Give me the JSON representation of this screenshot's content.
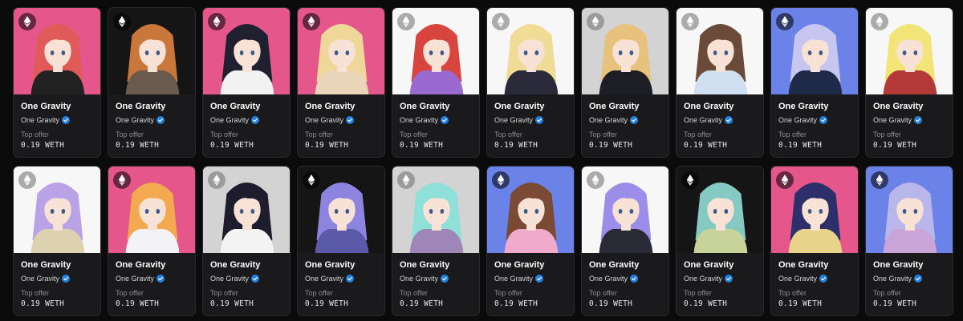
{
  "cards": [
    {
      "title": "One Gravity",
      "collection": "One Gravity",
      "offer_label": "Top offer",
      "offer_value": "0.19 WETH",
      "bg": "#e5578b",
      "hair": "#e05a5a",
      "outfit": "#222222",
      "chain": "dark"
    },
    {
      "title": "One Gravity",
      "collection": "One Gravity",
      "offer_label": "Top offer",
      "offer_value": "0.19 WETH",
      "bg": "#151515",
      "hair": "#c9773a",
      "outfit": "#6b5a4e",
      "chain": "dark"
    },
    {
      "title": "One Gravity",
      "collection": "One Gravity",
      "offer_label": "Top offer",
      "offer_value": "0.19 WETH",
      "bg": "#e5578b",
      "hair": "#202030",
      "outfit": "#f2f2f2",
      "chain": "dark"
    },
    {
      "title": "One Gravity",
      "collection": "One Gravity",
      "offer_label": "Top offer",
      "offer_value": "0.19 WETH",
      "bg": "#e5578b",
      "hair": "#efd79a",
      "outfit": "#e9d6b8",
      "chain": "dark"
    },
    {
      "title": "One Gravity",
      "collection": "One Gravity",
      "offer_label": "Top offer",
      "offer_value": "0.19 WETH",
      "bg": "#f7f7f7",
      "hair": "#d8453f",
      "outfit": "#9b6ad0",
      "chain": "light"
    },
    {
      "title": "One Gravity",
      "collection": "One Gravity",
      "offer_label": "Top offer",
      "offer_value": "0.19 WETH",
      "bg": "#f7f7f7",
      "hair": "#f0dc96",
      "outfit": "#2a2a3a",
      "chain": "light"
    },
    {
      "title": "One Gravity",
      "collection": "One Gravity",
      "offer_label": "Top offer",
      "offer_value": "0.19 WETH",
      "bg": "#d3d3d3",
      "hair": "#e6c27d",
      "outfit": "#1d1d26",
      "chain": "light"
    },
    {
      "title": "One Gravity",
      "collection": "One Gravity",
      "offer_label": "Top offer",
      "offer_value": "0.19 WETH",
      "bg": "#f7f7f7",
      "hair": "#6b4a3a",
      "outfit": "#cfdff0",
      "chain": "light"
    },
    {
      "title": "One Gravity",
      "collection": "One Gravity",
      "offer_label": "Top offer",
      "offer_value": "0.19 WETH",
      "bg": "#6b82e8",
      "hair": "#c6c6f0",
      "outfit": "#1e2a48",
      "chain": "dark"
    },
    {
      "title": "One Gravity",
      "collection": "One Gravity",
      "offer_label": "Top offer",
      "offer_value": "0.19 WETH",
      "bg": "#f7f7f7",
      "hair": "#f3e477",
      "outfit": "#b43a3a",
      "chain": "light"
    },
    {
      "title": "One Gravity",
      "collection": "One Gravity",
      "offer_label": "Top offer",
      "offer_value": "0.19 WETH",
      "bg": "#f7f7f7",
      "hair": "#b9a2e6",
      "outfit": "#ddd2b0",
      "chain": "light"
    },
    {
      "title": "One Gravity",
      "collection": "One Gravity",
      "offer_label": "Top offer",
      "offer_value": "0.19 WETH",
      "bg": "#e5578b",
      "hair": "#f2a94f",
      "outfit": "#f4f4f8",
      "chain": "dark"
    },
    {
      "title": "One Gravity",
      "collection": "One Gravity",
      "offer_label": "Top offer",
      "offer_value": "0.19 WETH",
      "bg": "#d3d3d3",
      "hair": "#1d1d2d",
      "outfit": "#f4f4f4",
      "chain": "light"
    },
    {
      "title": "One Gravity",
      "collection": "One Gravity",
      "offer_label": "Top offer",
      "offer_value": "0.19 WETH",
      "bg": "#151515",
      "hair": "#8d84e0",
      "outfit": "#5b5aa8",
      "chain": "dark"
    },
    {
      "title": "One Gravity",
      "collection": "One Gravity",
      "offer_label": "Top offer",
      "offer_value": "0.19 WETH",
      "bg": "#d3d3d3",
      "hair": "#8fe0d8",
      "outfit": "#9e87b8",
      "chain": "light"
    },
    {
      "title": "One Gravity",
      "collection": "One Gravity",
      "offer_label": "Top offer",
      "offer_value": "0.19 WETH",
      "bg": "#6b82e8",
      "hair": "#7b4a34",
      "outfit": "#f0aacb",
      "chain": "dark"
    },
    {
      "title": "One Gravity",
      "collection": "One Gravity",
      "offer_label": "Top offer",
      "offer_value": "0.19 WETH",
      "bg": "#f7f7f7",
      "hair": "#9c8ee8",
      "outfit": "#2a2a36",
      "chain": "light"
    },
    {
      "title": "One Gravity",
      "collection": "One Gravity",
      "offer_label": "Top offer",
      "offer_value": "0.19 WETH",
      "bg": "#151515",
      "hair": "#84c9c2",
      "outfit": "#c8d39a",
      "chain": "dark"
    },
    {
      "title": "One Gravity",
      "collection": "One Gravity",
      "offer_label": "Top offer",
      "offer_value": "0.19 WETH",
      "bg": "#e5578b",
      "hair": "#2c2f6a",
      "outfit": "#e8d38a",
      "chain": "dark"
    },
    {
      "title": "One Gravity",
      "collection": "One Gravity",
      "offer_label": "Top offer",
      "offer_value": "0.19 WETH",
      "bg": "#6b82e8",
      "hair": "#b8b6ea",
      "outfit": "#c9a4d8",
      "chain": "dark"
    }
  ]
}
